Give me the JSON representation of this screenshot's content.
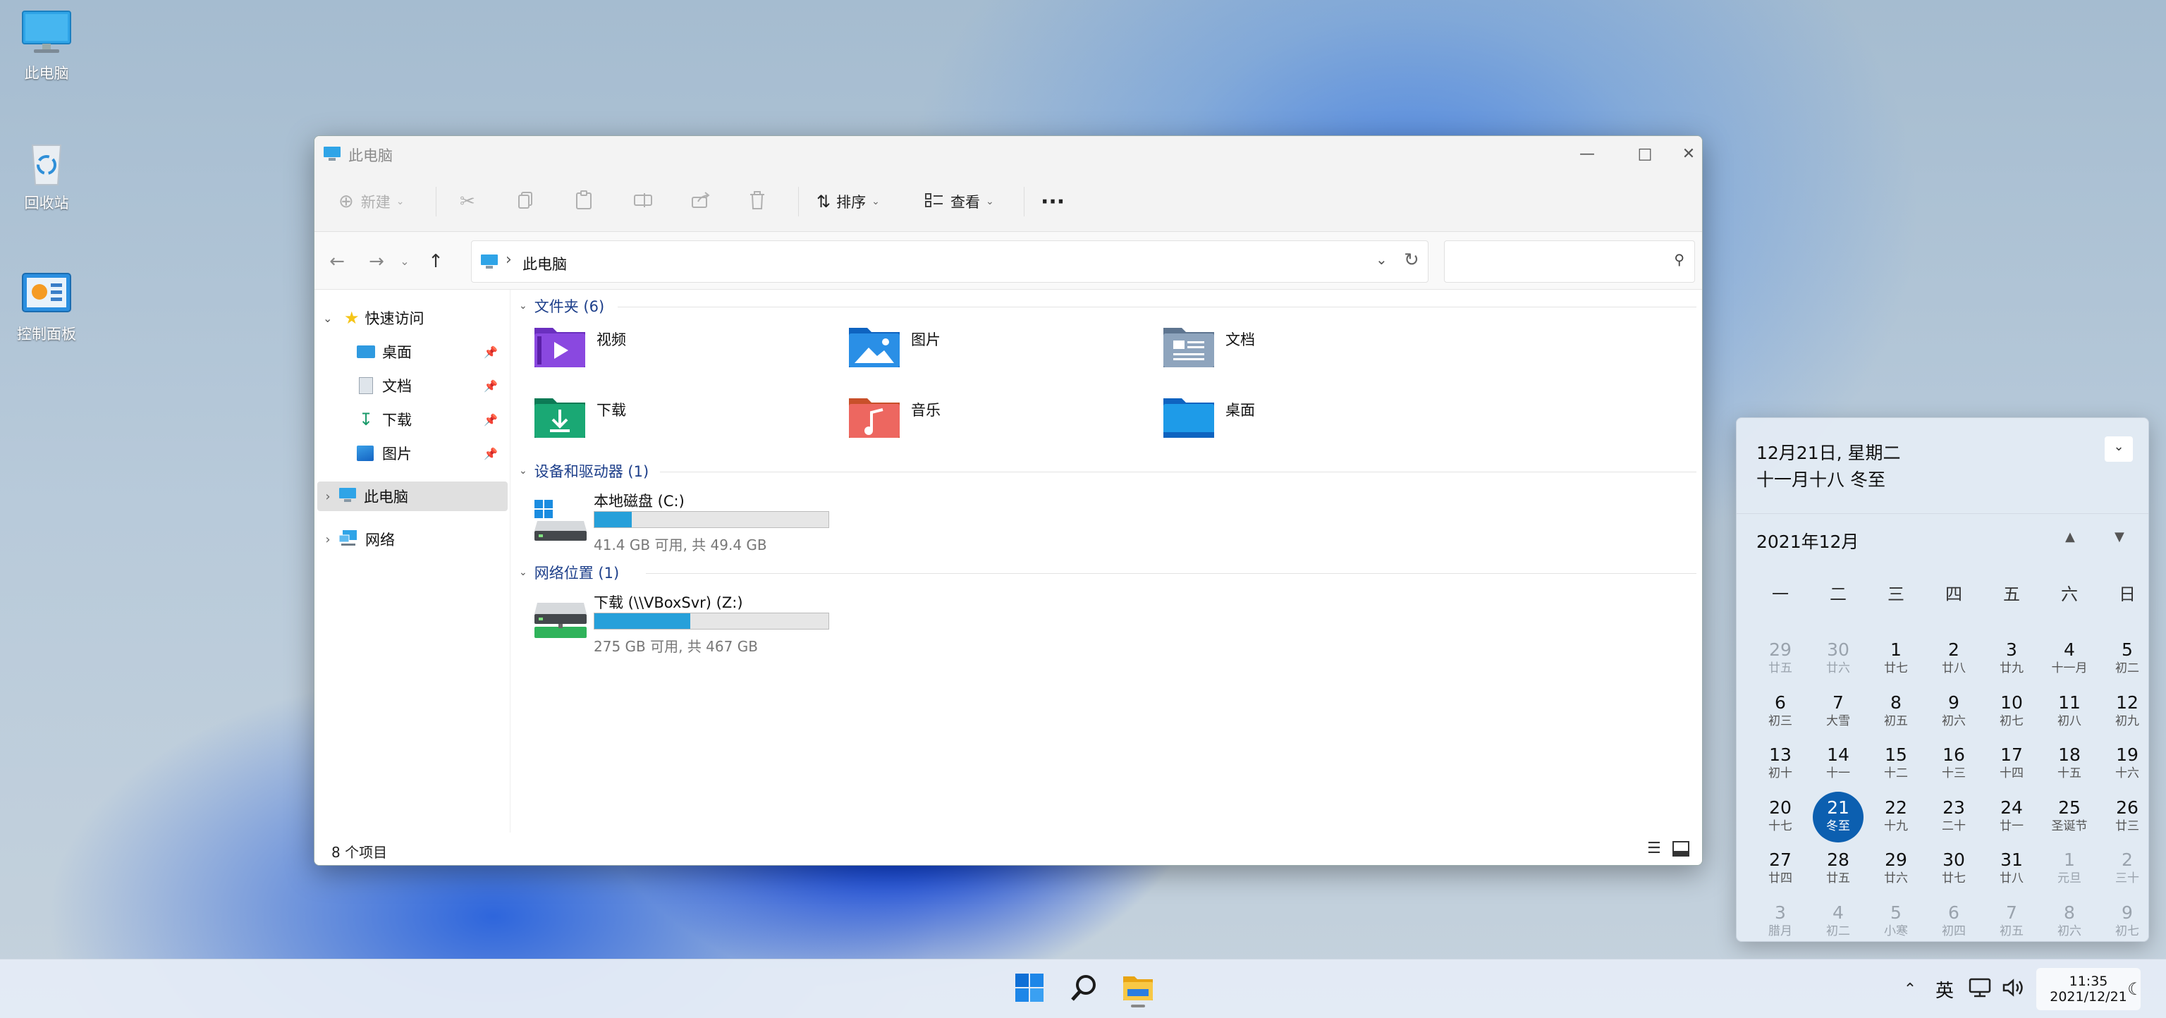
{
  "desktop": {
    "icons": [
      {
        "label": "此电脑",
        "icon": "computer-icon"
      },
      {
        "label": "回收站",
        "icon": "recycle-bin-icon"
      },
      {
        "label": "控制面板",
        "icon": "control-panel-icon"
      }
    ]
  },
  "window": {
    "title": "此电脑",
    "toolbar": {
      "new_label": "新建",
      "sort_label": "排序",
      "view_label": "查看",
      "more_label": "···"
    },
    "address": {
      "path_label": "此电脑",
      "separator": "›"
    },
    "search_placeholder": "",
    "sidebar": {
      "quick_access": "快速访问",
      "items": [
        {
          "label": "桌面"
        },
        {
          "label": "文档"
        },
        {
          "label": "下载"
        },
        {
          "label": "图片"
        }
      ],
      "this_pc": "此电脑",
      "network": "网络"
    },
    "sections": {
      "folders": "文件夹 (6)",
      "devices": "设备和驱动器 (1)",
      "network_locations": "网络位置 (1)"
    },
    "folders": [
      {
        "label": "视频",
        "icon": "videos-folder-icon"
      },
      {
        "label": "图片",
        "icon": "pictures-folder-icon"
      },
      {
        "label": "文档",
        "icon": "documents-folder-icon"
      },
      {
        "label": "下载",
        "icon": "downloads-folder-icon"
      },
      {
        "label": "音乐",
        "icon": "music-folder-icon"
      },
      {
        "label": "桌面",
        "icon": "desktop-folder-icon"
      }
    ],
    "drives": [
      {
        "name": "本地磁盘 (C:)",
        "detail": "41.4 GB 可用, 共 49.4 GB",
        "used_fraction": 0.16
      },
      {
        "name": "下载 (\\\\VBoxSvr) (Z:)",
        "detail": "275 GB 可用, 共 467 GB",
        "used_fraction": 0.41
      }
    ],
    "status": "8 个项目"
  },
  "calendar": {
    "date_line": "12月21日, 星期二",
    "lunar_line": "十一月十八 冬至",
    "month_label": "2021年12月",
    "weekdays": [
      "一",
      "二",
      "三",
      "四",
      "五",
      "六",
      "日"
    ],
    "weeks": [
      [
        {
          "n": "29",
          "l": "廿五",
          "o": true
        },
        {
          "n": "30",
          "l": "廿六",
          "o": true
        },
        {
          "n": "1",
          "l": "廿七"
        },
        {
          "n": "2",
          "l": "廿八"
        },
        {
          "n": "3",
          "l": "廿九"
        },
        {
          "n": "4",
          "l": "十一月"
        },
        {
          "n": "5",
          "l": "初二"
        }
      ],
      [
        {
          "n": "6",
          "l": "初三"
        },
        {
          "n": "7",
          "l": "大雪"
        },
        {
          "n": "8",
          "l": "初五"
        },
        {
          "n": "9",
          "l": "初六"
        },
        {
          "n": "10",
          "l": "初七"
        },
        {
          "n": "11",
          "l": "初八"
        },
        {
          "n": "12",
          "l": "初九"
        }
      ],
      [
        {
          "n": "13",
          "l": "初十"
        },
        {
          "n": "14",
          "l": "十一"
        },
        {
          "n": "15",
          "l": "十二"
        },
        {
          "n": "16",
          "l": "十三"
        },
        {
          "n": "17",
          "l": "十四"
        },
        {
          "n": "18",
          "l": "十五"
        },
        {
          "n": "19",
          "l": "十六"
        }
      ],
      [
        {
          "n": "20",
          "l": "十七"
        },
        {
          "n": "21",
          "l": "冬至",
          "sel": true
        },
        {
          "n": "22",
          "l": "十九"
        },
        {
          "n": "23",
          "l": "二十"
        },
        {
          "n": "24",
          "l": "廿一"
        },
        {
          "n": "25",
          "l": "圣诞节"
        },
        {
          "n": "26",
          "l": "廿三"
        }
      ],
      [
        {
          "n": "27",
          "l": "廿四"
        },
        {
          "n": "28",
          "l": "廿五"
        },
        {
          "n": "29",
          "l": "廿六"
        },
        {
          "n": "30",
          "l": "廿七"
        },
        {
          "n": "31",
          "l": "廿八"
        },
        {
          "n": "1",
          "l": "元旦",
          "o": true
        },
        {
          "n": "2",
          "l": "三十",
          "o": true
        }
      ],
      [
        {
          "n": "3",
          "l": "腊月",
          "o": true
        },
        {
          "n": "4",
          "l": "初二",
          "o": true
        },
        {
          "n": "5",
          "l": "小寒",
          "o": true
        },
        {
          "n": "6",
          "l": "初四",
          "o": true
        },
        {
          "n": "7",
          "l": "初五",
          "o": true
        },
        {
          "n": "8",
          "l": "初六",
          "o": true
        },
        {
          "n": "9",
          "l": "初七",
          "o": true
        }
      ]
    ]
  },
  "taskbar": {
    "ime": "英",
    "time": "11:35",
    "date": "2021/12/21"
  },
  "colors": {
    "accent": "#0c5fb0",
    "drive_bar": "#26a0da"
  }
}
